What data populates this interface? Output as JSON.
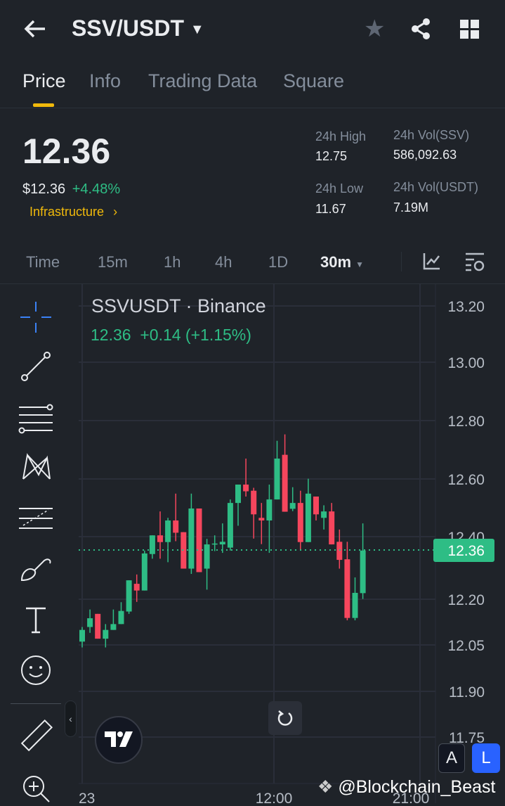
{
  "header": {
    "title": "SSV/USDT",
    "icons": [
      "back-arrow-icon",
      "star-icon",
      "share-icon",
      "grid-icon"
    ]
  },
  "tabs": [
    {
      "label": "Price",
      "active": true
    },
    {
      "label": "Info"
    },
    {
      "label": "Trading Data"
    },
    {
      "label": "Square"
    }
  ],
  "price": {
    "last": "12.36",
    "usd": "$12.36",
    "change": "+4.48%",
    "category": "Infrastructure"
  },
  "stats": {
    "high_label": "24h High",
    "high": "12.75",
    "low_label": "24h Low",
    "low": "11.67",
    "vol_base_label": "24h Vol(SSV)",
    "vol_base": "586,092.63",
    "vol_quote_label": "24h Vol(USDT)",
    "vol_quote": "7.19M"
  },
  "timeframes": {
    "items": [
      "Time",
      "15m",
      "1h",
      "4h",
      "1D"
    ],
    "selected": "30m"
  },
  "chart_legend": {
    "symbol": "SSVUSDT · Binance",
    "last": "12.36",
    "change": "+0.14 (+1.15%)"
  },
  "buttons": {
    "auto": "A",
    "log": "L"
  },
  "watermark": "@Blockchain_Beast",
  "colors": {
    "up": "#2ebd85",
    "down": "#f6465d",
    "accent": "#f0b90b",
    "bg": "#1f2329"
  },
  "chart_data": {
    "type": "candlestick",
    "y_ticks": [
      "13.20",
      "13.00",
      "12.80",
      "12.60",
      "12.40",
      "12.20",
      "12.05",
      "11.90",
      "11.75"
    ],
    "x_ticks": [
      "23",
      "12:00",
      "21:00"
    ],
    "last_price_label": "12.36",
    "ylim": [
      11.75,
      13.2
    ],
    "candles": [
      [
        12.05,
        12.1,
        12.03,
        12.09
      ],
      [
        12.1,
        12.16,
        12.08,
        12.13
      ],
      [
        12.145,
        12.145,
        12.06,
        12.06
      ],
      [
        12.06,
        12.11,
        12.03,
        12.09
      ],
      [
        12.09,
        12.16,
        12.09,
        12.11
      ],
      [
        12.11,
        12.185,
        12.11,
        12.155
      ],
      [
        12.153,
        12.26,
        12.145,
        12.26
      ],
      [
        12.248,
        12.28,
        12.186,
        12.225
      ],
      [
        12.225,
        12.362,
        12.225,
        12.352
      ],
      [
        12.35,
        12.414,
        12.334,
        12.414
      ],
      [
        12.414,
        12.496,
        12.334,
        12.391
      ],
      [
        12.391,
        12.474,
        12.322,
        12.465
      ],
      [
        12.465,
        12.557,
        12.394,
        12.423
      ],
      [
        12.425,
        12.425,
        12.3,
        12.3
      ],
      [
        12.3,
        12.557,
        12.282,
        12.506
      ],
      [
        12.506,
        12.506,
        12.288,
        12.288
      ],
      [
        12.3,
        12.402,
        12.228,
        12.383
      ],
      [
        12.383,
        12.414,
        12.36,
        12.386
      ],
      [
        12.383,
        12.455,
        12.354,
        12.392
      ],
      [
        12.372,
        12.537,
        12.362,
        12.525
      ],
      [
        12.525,
        12.588,
        12.447,
        12.588
      ],
      [
        12.588,
        12.677,
        12.547,
        12.565
      ],
      [
        12.567,
        12.577,
        12.403,
        12.486
      ],
      [
        12.474,
        12.525,
        12.384,
        12.465
      ],
      [
        12.465,
        12.588,
        12.354,
        12.537
      ],
      [
        12.537,
        12.738,
        12.537,
        12.677
      ],
      [
        12.69,
        12.76,
        12.495,
        12.495
      ],
      [
        12.505,
        12.579,
        12.497,
        12.525
      ],
      [
        12.525,
        12.567,
        12.364,
        12.391
      ],
      [
        12.391,
        12.608,
        12.391,
        12.557
      ],
      [
        12.547,
        12.547,
        12.465,
        12.486
      ],
      [
        12.474,
        12.517,
        12.434,
        12.496
      ],
      [
        12.496,
        12.525,
        12.383,
        12.383
      ],
      [
        12.392,
        12.434,
        12.3,
        12.33
      ],
      [
        12.332,
        12.392,
        12.123,
        12.131
      ],
      [
        12.131,
        12.27,
        12.123,
        12.217
      ],
      [
        12.216,
        12.455,
        12.196,
        12.362
      ]
    ],
    "candle_format": [
      "open",
      "high",
      "low",
      "close"
    ]
  }
}
